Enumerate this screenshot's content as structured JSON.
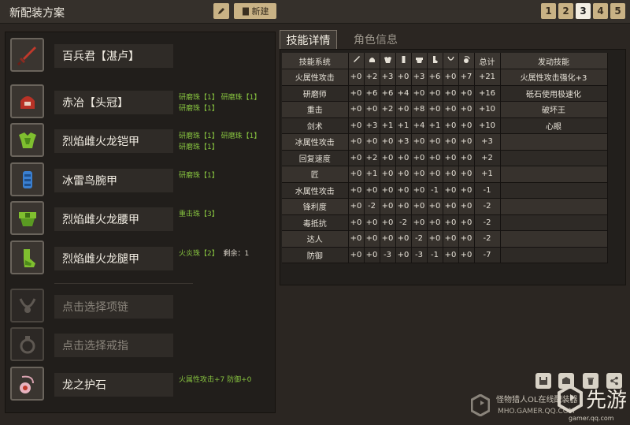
{
  "header": {
    "title": "新配装方案",
    "new_label": "新建",
    "pages": [
      "1",
      "2",
      "3",
      "4",
      "5"
    ],
    "active_page": "3"
  },
  "equipment": [
    {
      "name": "百兵君【湛卢】",
      "icon": "sword-icon",
      "jewels": []
    },
    {
      "name": "赤冶【头冠】",
      "icon": "helmet-icon",
      "jewels": [
        "研磨珠【1】  研磨珠【1】",
        "研磨珠【1】"
      ]
    },
    {
      "name": "烈焰雌火龙铠甲",
      "icon": "chest-armor-icon",
      "jewels": [
        "研磨珠【1】  研磨珠【1】",
        "研磨珠【1】"
      ]
    },
    {
      "name": "冰雷鸟腕甲",
      "icon": "gauntlet-icon",
      "jewels": [
        "研磨珠【1】"
      ]
    },
    {
      "name": "烈焰雌火龙腰甲",
      "icon": "waist-armor-icon",
      "jewels": [
        "重击珠【3】"
      ]
    },
    {
      "name": "烈焰雌火龙腿甲",
      "icon": "leg-armor-icon",
      "jewels": [
        "火炎珠【2】"
      ],
      "rest": "剩余：1"
    }
  ],
  "accessories": [
    {
      "name": "点击选择项链",
      "icon": "necklace-icon",
      "empty": true,
      "jewels": []
    },
    {
      "name": "点击选择戒指",
      "icon": "ring-icon",
      "empty": true,
      "jewels": []
    },
    {
      "name": "龙之护石",
      "icon": "talisman-icon",
      "empty": false,
      "jewels": [
        "火属性攻击+7  防御+0"
      ]
    }
  ],
  "tabs": {
    "skill_detail": "技能详情",
    "char_info": "角色信息"
  },
  "skill_table": {
    "header_name": "技能系统",
    "header_total": "总计",
    "header_trigger": "发动技能",
    "column_icons": [
      "sword-icon",
      "helmet-icon",
      "chest-armor-icon",
      "gauntlet-icon",
      "waist-armor-icon",
      "leg-armor-icon",
      "necklace-icon",
      "talisman-icon"
    ],
    "rows": [
      {
        "name": "火属性攻击",
        "vals": [
          "+0",
          "+2",
          "+3",
          "+0",
          "+3",
          "+6",
          "+0",
          "+7"
        ],
        "total": "+21",
        "trigger": "火属性攻击强化+3"
      },
      {
        "name": "研磨师",
        "vals": [
          "+0",
          "+6",
          "+6",
          "+4",
          "+0",
          "+0",
          "+0",
          "+0"
        ],
        "total": "+16",
        "trigger": "砥石使用极速化"
      },
      {
        "name": "重击",
        "vals": [
          "+0",
          "+0",
          "+2",
          "+0",
          "+8",
          "+0",
          "+0",
          "+0"
        ],
        "total": "+10",
        "trigger": "破坏王"
      },
      {
        "name": "剑术",
        "vals": [
          "+0",
          "+3",
          "+1",
          "+1",
          "+4",
          "+1",
          "+0",
          "+0"
        ],
        "total": "+10",
        "trigger": "心眼"
      },
      {
        "name": "冰属性攻击",
        "vals": [
          "+0",
          "+0",
          "+0",
          "+3",
          "+0",
          "+0",
          "+0",
          "+0"
        ],
        "total": "+3",
        "trigger": ""
      },
      {
        "name": "回复速度",
        "vals": [
          "+0",
          "+2",
          "+0",
          "+0",
          "+0",
          "+0",
          "+0",
          "+0"
        ],
        "total": "+2",
        "trigger": ""
      },
      {
        "name": "匠",
        "vals": [
          "+0",
          "+1",
          "+0",
          "+0",
          "+0",
          "+0",
          "+0",
          "+0"
        ],
        "total": "+1",
        "trigger": ""
      },
      {
        "name": "水属性攻击",
        "vals": [
          "+0",
          "+0",
          "+0",
          "+0",
          "+0",
          "-1",
          "+0",
          "+0"
        ],
        "total": "-1",
        "trigger": ""
      },
      {
        "name": "锋利度",
        "vals": [
          "+0",
          "-2",
          "+0",
          "+0",
          "+0",
          "+0",
          "+0",
          "+0"
        ],
        "total": "-2",
        "trigger": ""
      },
      {
        "name": "毒抵抗",
        "vals": [
          "+0",
          "+0",
          "+0",
          "-2",
          "+0",
          "+0",
          "+0",
          "+0"
        ],
        "total": "-2",
        "trigger": ""
      },
      {
        "name": "达人",
        "vals": [
          "+0",
          "+0",
          "+0",
          "+0",
          "-2",
          "+0",
          "+0",
          "+0"
        ],
        "total": "-2",
        "trigger": ""
      },
      {
        "name": "防御",
        "vals": [
          "+0",
          "+0",
          "-3",
          "+0",
          "-3",
          "-1",
          "+0",
          "+0"
        ],
        "total": "-7",
        "trigger": ""
      }
    ]
  },
  "watermark": {
    "line1": "怪物猎人OL在线配装器",
    "line2": "MHO.GAMER.QQ.COM",
    "brand": "先游",
    "url": "gamer.qq.com"
  },
  "colors": {
    "jewel": "#86c23f",
    "button": "#c9b285",
    "panel": "#211e1b"
  }
}
